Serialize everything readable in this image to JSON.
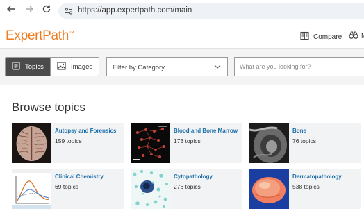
{
  "browser": {
    "url": "https://app.expertpath.com/main"
  },
  "header": {
    "logo_text": "ExpertPath",
    "logo_mark": "™",
    "compare_label": "Compare",
    "more_label": "M"
  },
  "toolbar": {
    "tabs": [
      {
        "label": "Topics",
        "active": true
      },
      {
        "label": "Images",
        "active": false
      }
    ],
    "filter_label": "Filter by Category",
    "search_placeholder": "What are you looking for?"
  },
  "browse": {
    "title": "Browse topics",
    "cards": [
      {
        "title": "Autopsy and Forensics",
        "count": "159 topics"
      },
      {
        "title": "Blood and Bone Marrow",
        "count": "173 topics"
      },
      {
        "title": "Bone",
        "count": "76 topics"
      },
      {
        "title": "Clinical Chemistry",
        "count": "69 topics"
      },
      {
        "title": "Cytopathology",
        "count": "276 topics"
      },
      {
        "title": "Dermatopathology",
        "count": "538 topics"
      }
    ]
  },
  "colors": {
    "brand": "#f07a1d",
    "link": "#1d6fa8",
    "active_tab": "#4b4b4b"
  }
}
